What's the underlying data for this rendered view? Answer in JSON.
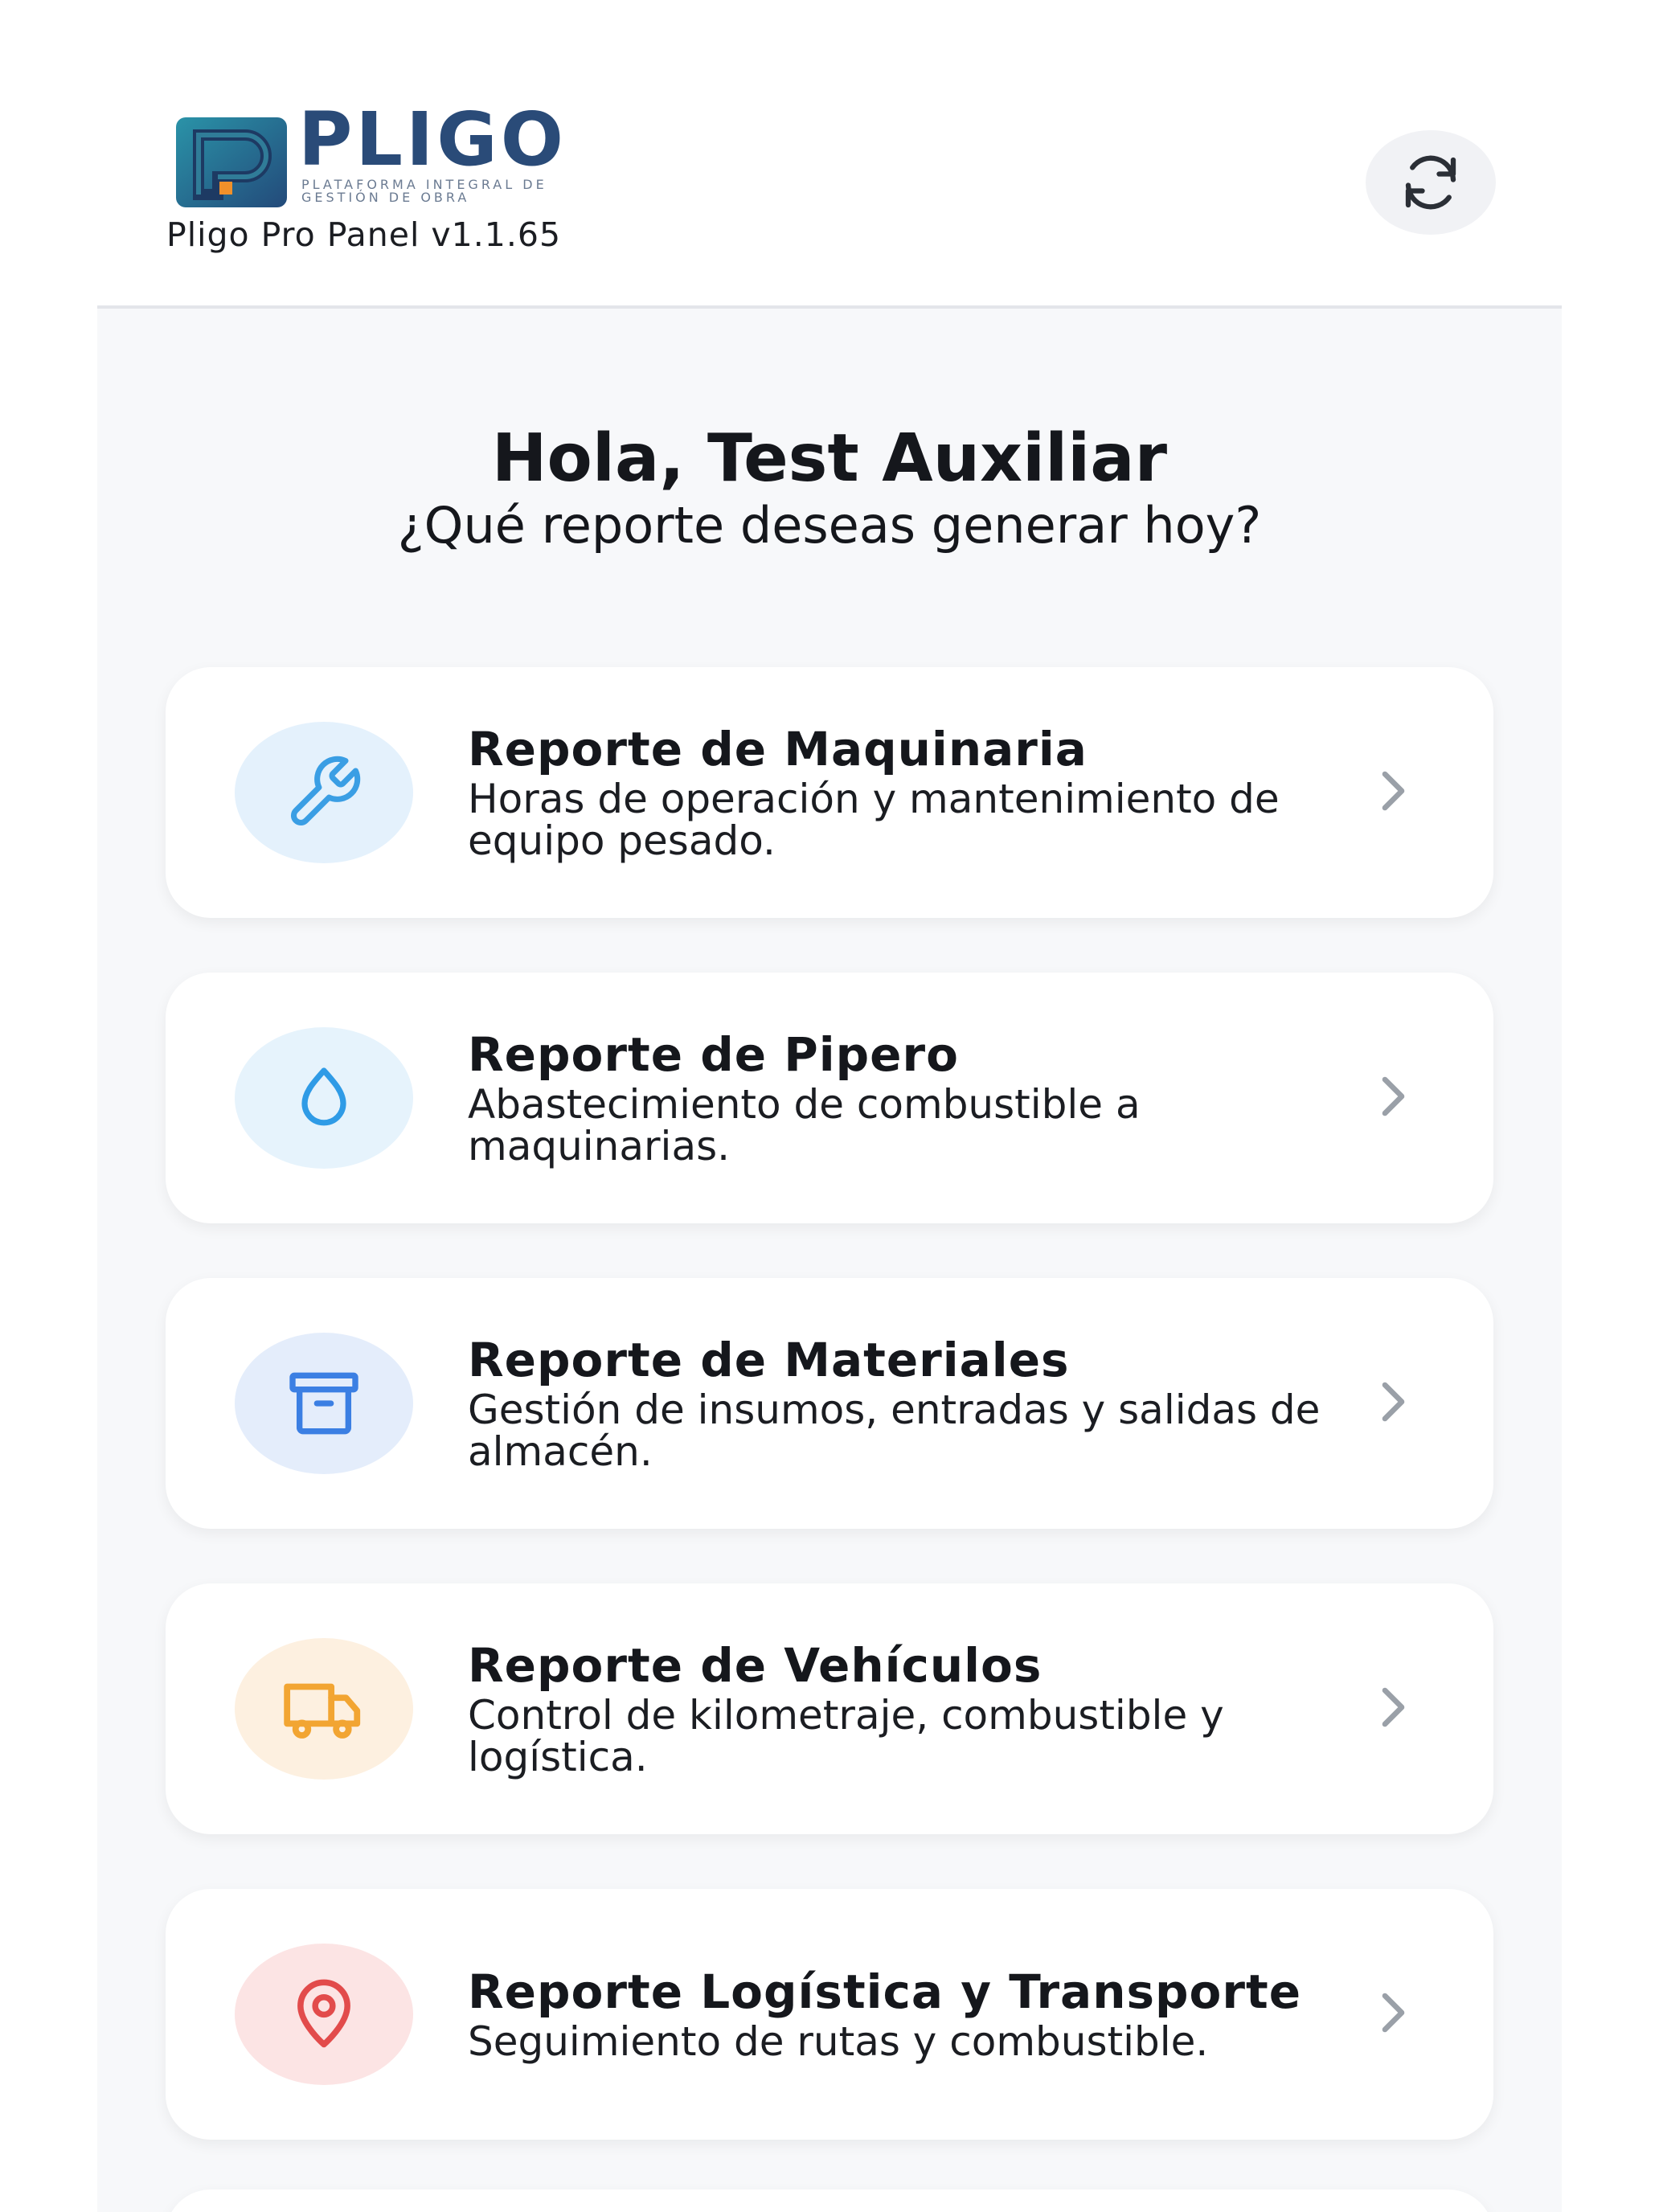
{
  "header": {
    "logo_word": "PLIGO",
    "logo_tagline": "PLATAFORMA INTEGRAL DE GESTIÓN DE OBRA",
    "version": "Pligo Pro Panel v1.1.65",
    "refresh_icon": "refresh-icon"
  },
  "greeting": {
    "title": "Hola, Test Auxiliar",
    "subtitle": "¿Qué reporte deseas generar hoy?"
  },
  "reports": [
    {
      "title": "Reporte de Maquinaria",
      "description": "Horas de operación y mantenimiento de equipo pesado.",
      "icon": "wrench-icon",
      "icon_color": "#3a9ee4",
      "icon_bg": "#e4f1fc"
    },
    {
      "title": "Reporte de Pipero",
      "description": "Abastecimiento de combustible a maquinarias.",
      "icon": "droplet-icon",
      "icon_color": "#2f9be6",
      "icon_bg": "#e6f3fc"
    },
    {
      "title": "Reporte de Materiales",
      "description": "Gestión de insumos, entradas y salidas de almacén.",
      "icon": "archive-box-icon",
      "icon_color": "#3b7fe3",
      "icon_bg": "#e4edfb"
    },
    {
      "title": "Reporte de Vehículos",
      "description": "Control de kilometraje, combustible y logística.",
      "icon": "truck-icon",
      "icon_color": "#f2a532",
      "icon_bg": "#fdf0e0"
    },
    {
      "title": "Reporte Logística y Transporte",
      "description": "Seguimiento de rutas y combustible.",
      "icon": "map-pin-icon",
      "icon_color": "#e24b4b",
      "icon_bg": "#fce4e4"
    }
  ],
  "colors": {
    "brand_dark": "#2a4b78",
    "brand_teal": "#2a8aa0",
    "brand_orange": "#f0902a",
    "background": "#f7f8fa",
    "chevron": "#9aa0a8"
  }
}
